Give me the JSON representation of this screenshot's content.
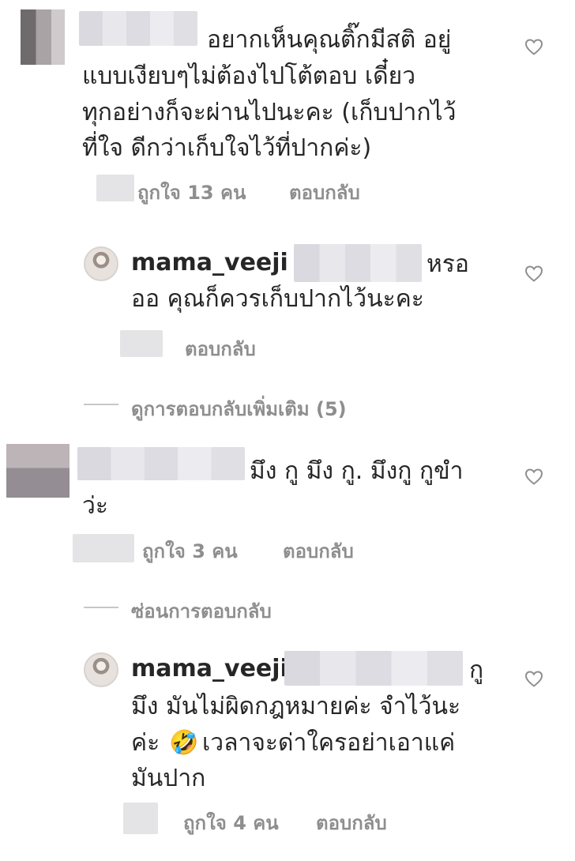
{
  "comments": [
    {
      "lines": [
        "อยากเห็นคุณติ๊กมีสติ อยู่",
        "แบบเงียบๆไม่ต้องไปโต้ตอบ เดี๋ยว",
        "ทุกอย่างก็จะผ่านไปนะคะ (เก็บปากไว้",
        "ที่ใจ ดีกว่าเก็บใจไว้ที่ปากค่ะ)"
      ],
      "likes": "ถูกใจ 13 คน",
      "reply_label": "ตอบกลับ"
    },
    {
      "username": "mama_veeji",
      "trailing": "หรอ",
      "lines": [
        "ออ คุณก็ควรเก็บปากไว้นะคะ"
      ],
      "reply_label": "ตอบกลับ"
    },
    {
      "view_more": "ดูการตอบกลับเพิ่มเติม (5)"
    },
    {
      "lines": [
        "มึง กู มึง กู. มึงกู  กูขำ",
        "ว่ะ"
      ],
      "likes": "ถูกใจ 3 คน",
      "reply_label": "ตอบกลับ",
      "hide_replies": "ซ่อนการตอบกลับ"
    },
    {
      "username": "mama_veeji",
      "trailing": "กู",
      "lines": [
        "มึง มันไม่ผิดกฎหมายค่ะ จำไว้นะ",
        "ค่ะ",
        "เวลาจะด่าใครอย่าเอาแค่",
        "มันปาก"
      ],
      "emoji": "🤣",
      "likes": "ถูกใจ 4 คน",
      "reply_label": "ตอบกลับ"
    }
  ],
  "icons": {
    "heart": "heart-outline-icon",
    "emoji": "rofl-emoji-icon"
  },
  "colors": {
    "text": "#262626",
    "meta": "#8e8e8e"
  }
}
